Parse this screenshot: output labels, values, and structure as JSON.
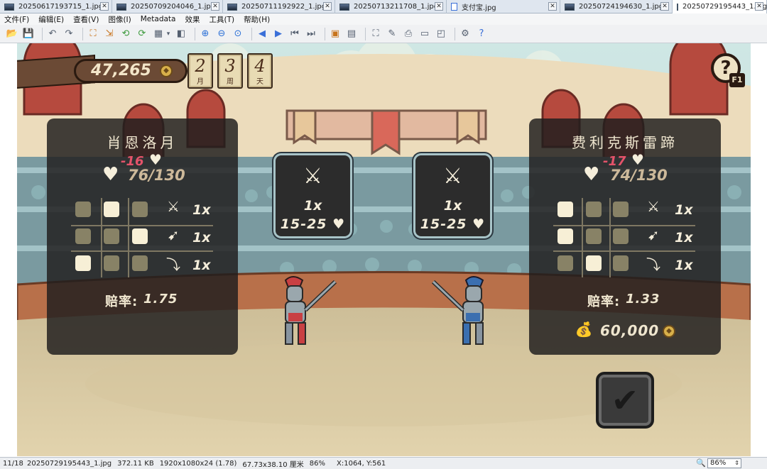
{
  "tabs": [
    {
      "label": "20250617193715_1.jpg",
      "type": "image",
      "active": false
    },
    {
      "label": "20250709204046_1.jpg",
      "type": "image",
      "active": false
    },
    {
      "label": "20250711192922_1.jpg",
      "type": "image",
      "active": false
    },
    {
      "label": "20250713211708_1.jpg",
      "type": "image",
      "active": false
    },
    {
      "label": "支付宝.jpg",
      "type": "doc",
      "active": false
    },
    {
      "label": "20250724194630_1.jpg",
      "type": "image",
      "active": false
    },
    {
      "label": "20250729195443_1.jpg",
      "type": "image",
      "active": true
    }
  ],
  "tab_close": "✕",
  "menu": [
    "文件(F)",
    "编辑(E)",
    "查看(V)",
    "图像(I)",
    "Metadata",
    "效果",
    "工具(T)",
    "帮助(H)"
  ],
  "toolbar_icons": [
    "open-folder",
    "save",
    "undo",
    "redo",
    "crop",
    "resize",
    "rotate-left",
    "rotate-right",
    "colors",
    "chevron-down",
    "adjust",
    "zoom-in",
    "zoom-out",
    "zoom-fit",
    "prev",
    "next",
    "first",
    "last",
    "slideshow",
    "batch",
    "fullscreen",
    "edit",
    "print",
    "scan",
    "capture",
    "settings",
    "help"
  ],
  "game": {
    "money": "47,265",
    "date": [
      {
        "num": "2",
        "unit": "月"
      },
      {
        "num": "3",
        "unit": "周"
      },
      {
        "num": "4",
        "unit": "天"
      }
    ],
    "help_key": "F1",
    "help_symbol": "?",
    "left": {
      "name": "肖恩洛月",
      "damage": "-16",
      "hp": "76/130",
      "grid": [
        0,
        1,
        0,
        0,
        0,
        1,
        1,
        0,
        0
      ],
      "moves": [
        {
          "icon": "overhead-slash-stance",
          "mult": "1x"
        },
        {
          "icon": "thrust-stance",
          "mult": "1x"
        },
        {
          "icon": "low-sweep-stance",
          "mult": "1x"
        }
      ],
      "odds_label": "赔率:",
      "odds_value": "1.75",
      "color": "#c94043"
    },
    "right": {
      "name": "费利克斯雷蹄",
      "damage": "-17",
      "hp": "74/130",
      "grid": [
        1,
        0,
        0,
        1,
        0,
        0,
        0,
        1,
        0
      ],
      "moves": [
        {
          "icon": "overhead-slash-stance",
          "mult": "1x"
        },
        {
          "icon": "thrust-stance",
          "mult": "1x"
        },
        {
          "icon": "low-sweep-stance",
          "mult": "1x"
        }
      ],
      "odds_label": "赔率:",
      "odds_value": "1.33",
      "bet": "60,000",
      "color": "#3b6fb0"
    },
    "cards": [
      {
        "mult": "1x",
        "range": "15-25"
      },
      {
        "mult": "1x",
        "range": "15-25"
      }
    ],
    "confirm_icon": "checkmark-icon"
  },
  "status": {
    "index": "11/18",
    "filename": "20250729195443_1.jpg",
    "filesize": "372.11 KB",
    "dimensions": "1920x1080x24 (1.78)",
    "physical": "67.73x38.10 厘米",
    "zoom_pct": "86%",
    "cursor": "X:1064, Y:561",
    "zoom_select": "86%"
  }
}
